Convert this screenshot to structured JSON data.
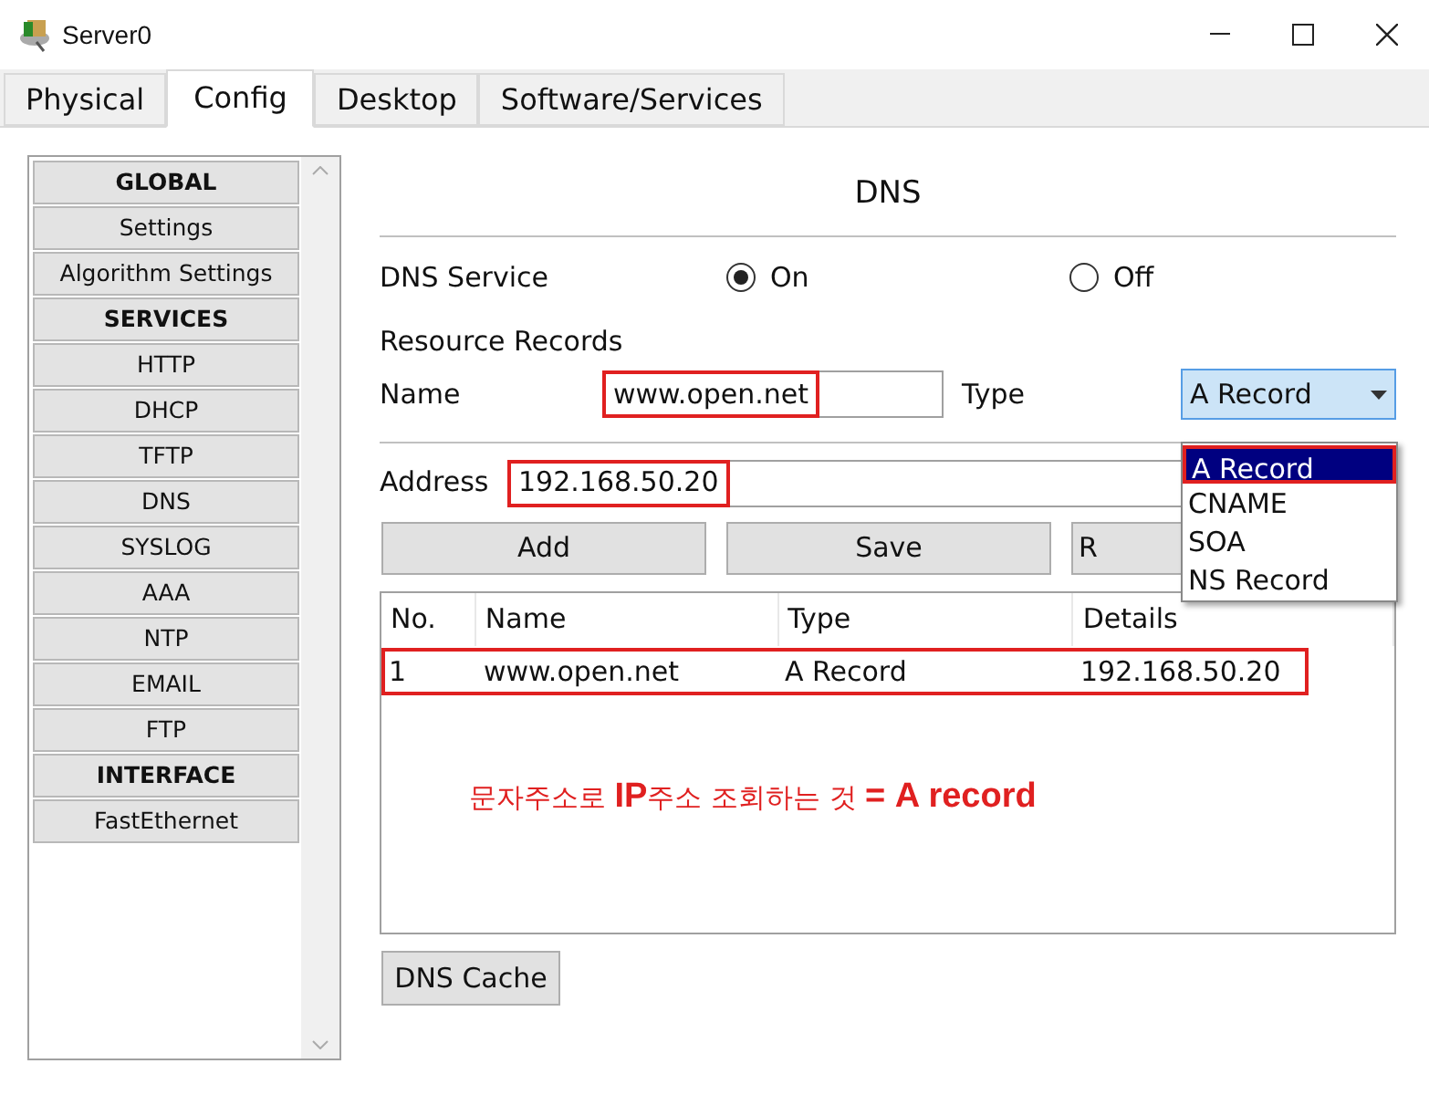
{
  "window": {
    "title": "Server0"
  },
  "tabs": [
    {
      "label": "Physical",
      "selected": false
    },
    {
      "label": "Config",
      "selected": true
    },
    {
      "label": "Desktop",
      "selected": false
    },
    {
      "label": "Software/Services",
      "selected": false
    }
  ],
  "sidebar": {
    "items": [
      {
        "label": "GLOBAL",
        "kind": "header",
        "selected": false
      },
      {
        "label": "Settings",
        "kind": "item",
        "selected": false
      },
      {
        "label": "Algorithm Settings",
        "kind": "item",
        "selected": false
      },
      {
        "label": "SERVICES",
        "kind": "header",
        "selected": false
      },
      {
        "label": "HTTP",
        "kind": "item",
        "selected": false
      },
      {
        "label": "DHCP",
        "kind": "item",
        "selected": false
      },
      {
        "label": "TFTP",
        "kind": "item",
        "selected": false
      },
      {
        "label": "DNS",
        "kind": "item",
        "selected": false
      },
      {
        "label": "SYSLOG",
        "kind": "item",
        "selected": false
      },
      {
        "label": "AAA",
        "kind": "item",
        "selected": false
      },
      {
        "label": "NTP",
        "kind": "item",
        "selected": false
      },
      {
        "label": "EMAIL",
        "kind": "item",
        "selected": false
      },
      {
        "label": "FTP",
        "kind": "item",
        "selected": false
      },
      {
        "label": "INTERFACE",
        "kind": "header",
        "selected": false
      },
      {
        "label": "FastEthernet",
        "kind": "item",
        "selected": false
      }
    ]
  },
  "dns": {
    "title": "DNS",
    "service_label": "DNS Service",
    "service_options": [
      {
        "label": "On",
        "selected": true
      },
      {
        "label": "Off",
        "selected": false
      }
    ],
    "resource_records_label": "Resource Records",
    "name_label": "Name",
    "name_value": "www.open.net",
    "name_highlighted": true,
    "type_label": "Type",
    "type_value": "A Record",
    "type_dropdown": {
      "expanded": true,
      "options": [
        {
          "label": "A Record",
          "selected": true,
          "highlighted": true
        },
        {
          "label": "CNAME",
          "selected": false,
          "highlighted": false
        },
        {
          "label": "SOA",
          "selected": false,
          "highlighted": false
        },
        {
          "label": "NS Record",
          "selected": false,
          "highlighted": false
        }
      ]
    },
    "address_label": "Address",
    "address_value": "192.168.50.20",
    "address_highlighted": true,
    "buttons": [
      "Add",
      "Save",
      "R"
    ],
    "table": {
      "columns": [
        "No.",
        "Name",
        "Type",
        "Details"
      ],
      "rows": [
        {
          "cells": [
            "1",
            "www.open.net",
            "A Record",
            "192.168.50.20"
          ],
          "highlighted": true
        }
      ]
    },
    "annotation": "문자주소로 **IP**주소 조회하는 것 **= A record**",
    "cache_button": "DNS Cache"
  }
}
